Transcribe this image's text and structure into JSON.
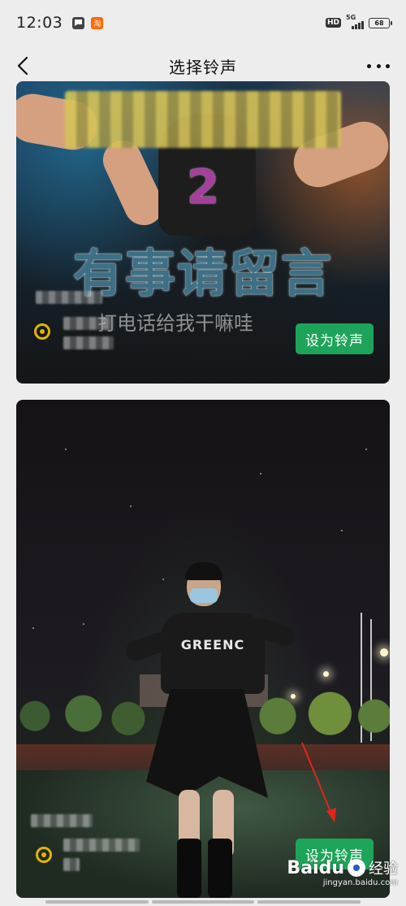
{
  "status_bar": {
    "time": "12:03",
    "network": "5G",
    "hd": "HD",
    "battery": "68"
  },
  "nav": {
    "title": "选择铃声"
  },
  "cards": [
    {
      "big_digit": "2",
      "big_text": "有事请留言",
      "sub_text": "打电话给我干嘛哇",
      "set_button_label": "设为铃声"
    },
    {
      "shirt_print": "GREENC",
      "set_button_label": "设为铃声"
    }
  ],
  "watermark": {
    "brand": "Baidu",
    "product": "经验",
    "url": "jingyan.baidu.com"
  },
  "colors": {
    "accent_green": "#1ea45a",
    "background": "#ededed"
  },
  "icons": {
    "back": "chevron-left-icon",
    "more": "more-dots-icon",
    "rate": "ringtone-rate-icon"
  }
}
